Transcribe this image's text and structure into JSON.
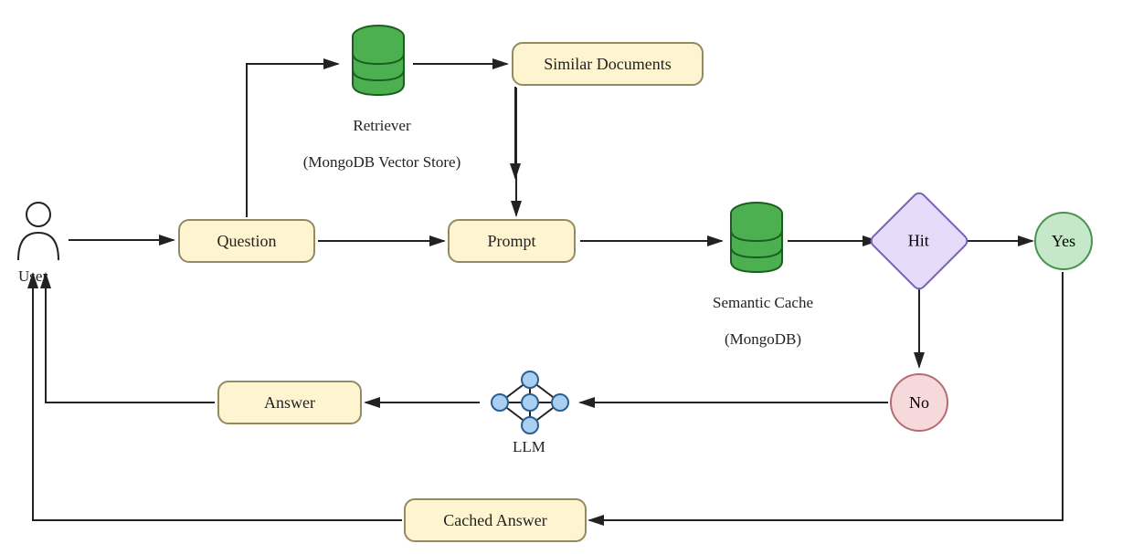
{
  "nodes": {
    "user": {
      "label": "User"
    },
    "question": {
      "label": "Question"
    },
    "retriever_label": {
      "line1": "Retriever",
      "line2": "(MongoDB Vector Store)"
    },
    "similar_docs": {
      "label": "Similar Documents"
    },
    "prompt": {
      "label": "Prompt"
    },
    "semantic_cache_label": {
      "line1": "Semantic Cache",
      "line2": "(MongoDB)"
    },
    "hit": {
      "label": "Hit"
    },
    "yes": {
      "label": "Yes"
    },
    "no": {
      "label": "No"
    },
    "llm_label": {
      "label": "LLM"
    },
    "answer": {
      "label": "Answer"
    },
    "cached_answer": {
      "label": "Cached Answer"
    }
  }
}
